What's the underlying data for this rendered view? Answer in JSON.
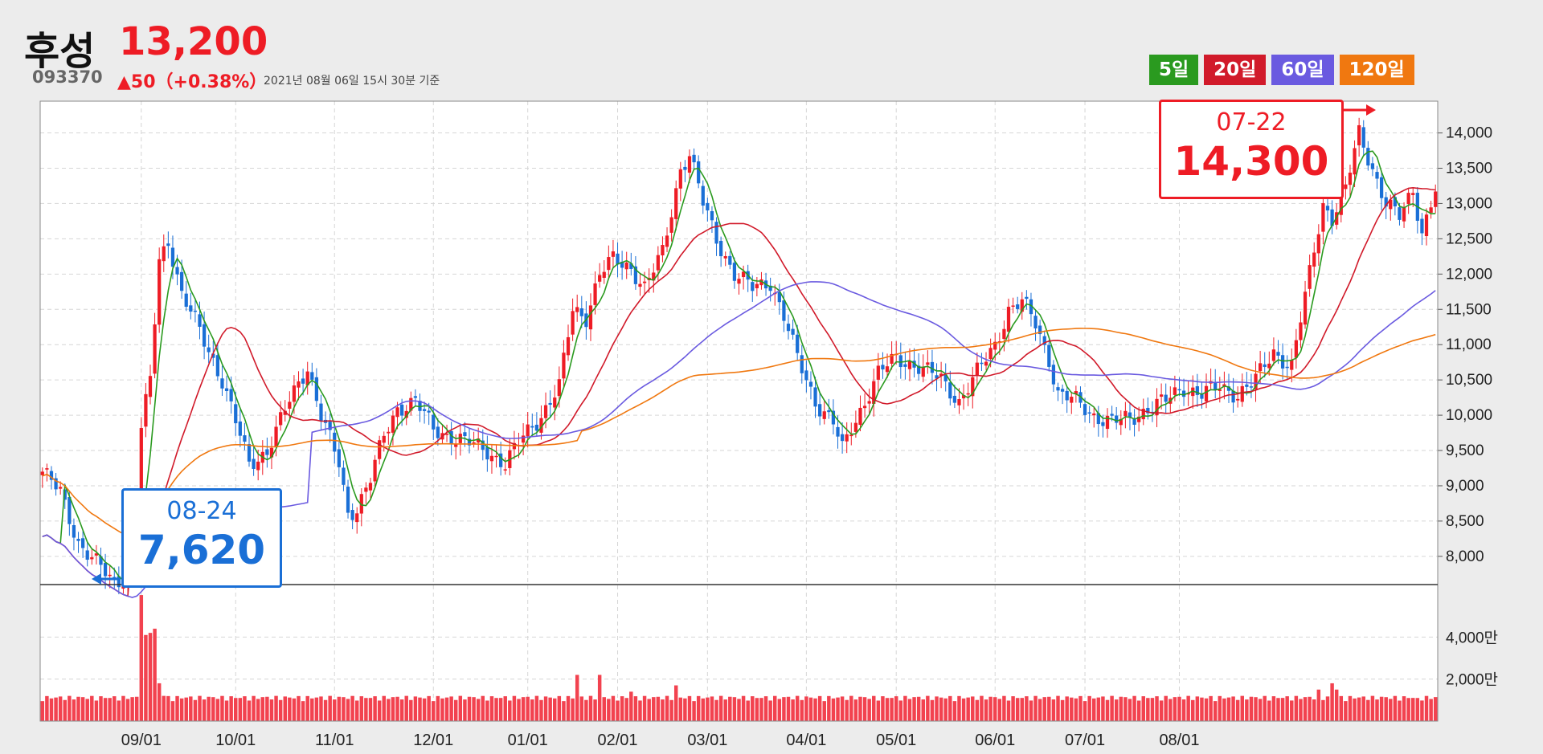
{
  "header": {
    "stock_name": "후성",
    "price": "13,200",
    "code": "093370",
    "change": "▲50（+0.38%）",
    "timestamp": "2021년 08월 06일 15시 30분 기준"
  },
  "ma_legend": [
    {
      "label": "5일",
      "color": "#2a9a1f"
    },
    {
      "label": "20일",
      "color": "#d11a2a"
    },
    {
      "label": "60일",
      "color": "#6a5ae0"
    },
    {
      "label": "120일",
      "color": "#f07810"
    }
  ],
  "colors": {
    "up": "#ee1c25",
    "down": "#1a6fd6",
    "volume": "#f2424f"
  },
  "callouts": {
    "high": {
      "date": "07-22",
      "value": "14,300"
    },
    "low": {
      "date": "08-24",
      "value": "7,620"
    }
  },
  "chart_data": {
    "type": "candlestick",
    "price_axis": {
      "ticks": [
        "8,000",
        "8,500",
        "9,000",
        "9,500",
        "10,000",
        "10,500",
        "11,000",
        "11,500",
        "12,000",
        "12,500",
        "13,000",
        "13,500",
        "14,000"
      ],
      "range": [
        7600,
        14450
      ]
    },
    "volume_axis": {
      "ticks": [
        "2,000만",
        "4,000만"
      ],
      "range": [
        0,
        6500
      ]
    },
    "x_axis": {
      "labels": [
        "09/01",
        "10/01",
        "11/01",
        "12/01",
        "01/01",
        "02/01",
        "03/01",
        "04/01",
        "05/01",
        "06/01",
        "07/01",
        "08/01"
      ]
    },
    "grid": true,
    "anchors": [
      [
        0,
        9200
      ],
      [
        4,
        8900
      ],
      [
        8,
        8200
      ],
      [
        12,
        7900
      ],
      [
        16,
        7620
      ],
      [
        20,
        7800
      ],
      [
        22,
        9800
      ],
      [
        24,
        10500
      ],
      [
        26,
        12200
      ],
      [
        28,
        12500
      ],
      [
        31,
        11700
      ],
      [
        35,
        11200
      ],
      [
        40,
        10500
      ],
      [
        44,
        9700
      ],
      [
        46,
        9300
      ],
      [
        50,
        9500
      ],
      [
        55,
        10200
      ],
      [
        59,
        10700
      ],
      [
        62,
        10000
      ],
      [
        66,
        9300
      ],
      [
        68,
        8600
      ],
      [
        70,
        8700
      ],
      [
        73,
        9100
      ],
      [
        76,
        9700
      ],
      [
        79,
        10100
      ],
      [
        83,
        10200
      ],
      [
        87,
        9800
      ],
      [
        91,
        9700
      ],
      [
        95,
        9600
      ],
      [
        99,
        9500
      ],
      [
        103,
        9300
      ],
      [
        107,
        9700
      ],
      [
        111,
        10000
      ],
      [
        115,
        10400
      ],
      [
        118,
        11500
      ],
      [
        121,
        11400
      ],
      [
        124,
        12000
      ],
      [
        127,
        12200
      ],
      [
        131,
        12100
      ],
      [
        134,
        11800
      ],
      [
        138,
        12300
      ],
      [
        142,
        13500
      ],
      [
        144,
        13700
      ],
      [
        147,
        13000
      ],
      [
        150,
        12500
      ],
      [
        154,
        12000
      ],
      [
        158,
        11800
      ],
      [
        162,
        11900
      ],
      [
        165,
        11400
      ],
      [
        168,
        10800
      ],
      [
        172,
        10200
      ],
      [
        176,
        9900
      ],
      [
        178,
        9500
      ],
      [
        180,
        9800
      ],
      [
        183,
        10200
      ],
      [
        186,
        10600
      ],
      [
        190,
        10800
      ],
      [
        195,
        10700
      ],
      [
        200,
        10500
      ],
      [
        204,
        10200
      ],
      [
        208,
        10600
      ],
      [
        212,
        11000
      ],
      [
        215,
        11500
      ],
      [
        218,
        11600
      ],
      [
        221,
        11300
      ],
      [
        224,
        10800
      ],
      [
        226,
        10300
      ],
      [
        230,
        10200
      ],
      [
        234,
        10000
      ],
      [
        238,
        9900
      ],
      [
        242,
        9950
      ],
      [
        246,
        10100
      ],
      [
        250,
        10200
      ],
      [
        254,
        10400
      ],
      [
        258,
        10300
      ],
      [
        262,
        10400
      ],
      [
        266,
        10300
      ],
      [
        270,
        10500
      ],
      [
        274,
        10900
      ],
      [
        278,
        10700
      ],
      [
        282,
        12000
      ],
      [
        285,
        13000
      ],
      [
        287,
        12800
      ],
      [
        290,
        13200
      ],
      [
        293,
        14000
      ],
      [
        296,
        13500
      ],
      [
        299,
        13000
      ],
      [
        302,
        12800
      ],
      [
        305,
        13200
      ],
      [
        307,
        12600
      ],
      [
        310,
        13200
      ]
    ],
    "volume_spikes": [
      [
        22,
        6000
      ],
      [
        23,
        4100
      ],
      [
        24,
        4200
      ],
      [
        25,
        4400
      ],
      [
        26,
        1800
      ],
      [
        27,
        1200
      ],
      [
        119,
        2200
      ],
      [
        124,
        2200
      ],
      [
        131,
        1400
      ],
      [
        141,
        1700
      ],
      [
        284,
        1500
      ],
      [
        287,
        1800
      ],
      [
        288,
        1500
      ],
      [
        306,
        1100
      ]
    ]
  }
}
